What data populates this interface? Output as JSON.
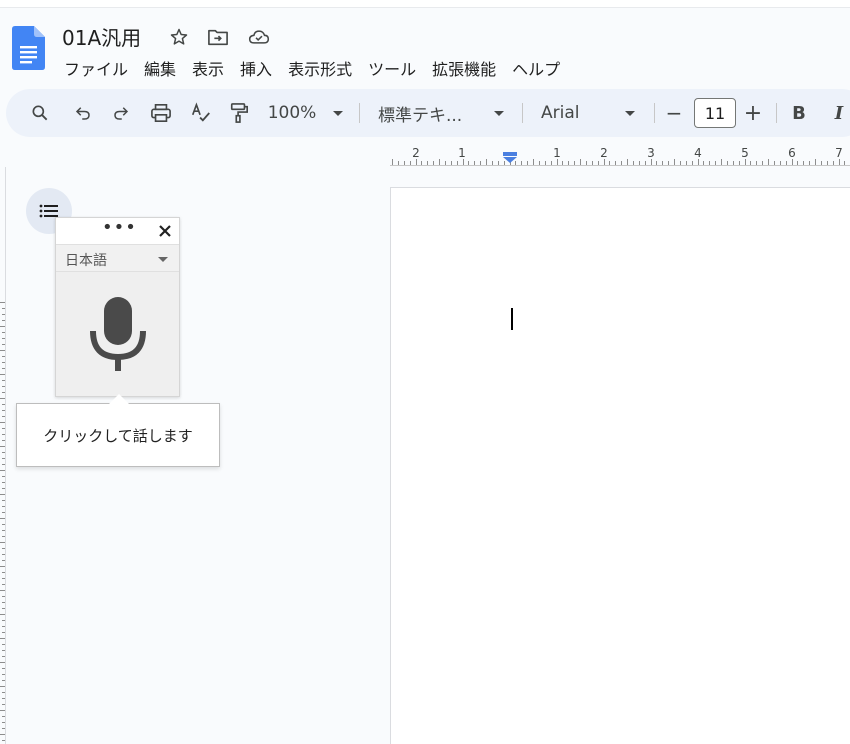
{
  "document": {
    "title": "01A汎用"
  },
  "menu": [
    "ファイル",
    "編集",
    "表示",
    "挿入",
    "表示形式",
    "ツール",
    "拡張機能",
    "ヘルプ"
  ],
  "toolbar": {
    "zoom": "100%",
    "style": "標準テキ...",
    "font": "Arial",
    "font_size": "11",
    "bold_label": "B",
    "italic_label": "I",
    "minus_label": "−",
    "plus_label": "+"
  },
  "ruler": {
    "labels": [
      "2",
      "1",
      "1",
      "2",
      "3",
      "4",
      "5",
      "6",
      "7"
    ]
  },
  "voice_typing": {
    "more_label": "•••",
    "language": "日本語",
    "tooltip": "クリックして話します"
  },
  "colors": {
    "docs_blue": "#4285f4",
    "toolbar_bg": "#edf2fa",
    "ruler_marker": "#4a7fe0"
  }
}
